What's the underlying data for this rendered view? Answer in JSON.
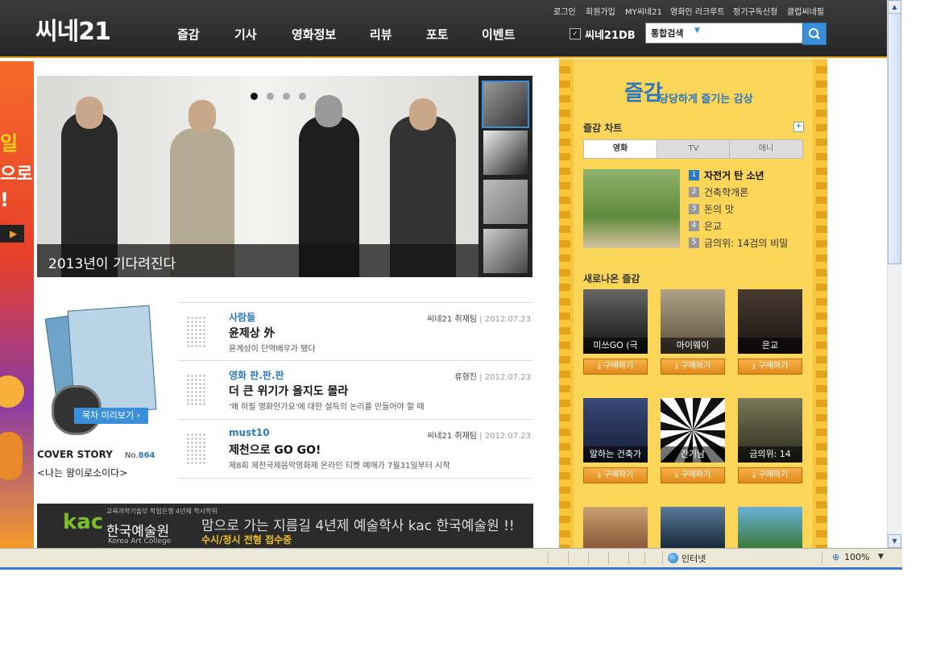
{
  "header": {
    "logo": "씨네21",
    "nav": [
      "즐감",
      "기사",
      "영화정보",
      "리뷰",
      "포토",
      "이벤트"
    ],
    "util_links": [
      "로그인",
      "회원가입",
      "MY씨네21",
      "영화인 리크루트",
      "정기구독신청",
      "클럽씨네필"
    ],
    "db_label": "씨네21DB",
    "search_scope": "통합검색",
    "search_value": ""
  },
  "left_ad": {
    "texts": [
      "일",
      "으로",
      "!"
    ]
  },
  "hero": {
    "caption": "2013년이 기다려진다",
    "dots": 4,
    "active_dot": 0
  },
  "cover": {
    "toc_button": "목차 미리보기 ›",
    "label": "COVER STORY",
    "no_prefix": "No.",
    "no_value": "864",
    "title": "<나는 왕이로소이다>"
  },
  "articles": [
    {
      "category": "사람들",
      "author": "씨네21 취재팀",
      "date": "2012.07.23",
      "title": "윤제상 外",
      "desc": "윤계상이 단역배우가 됐다"
    },
    {
      "category": "영화 판.판.판",
      "author": "류형진",
      "date": "2012.07.23",
      "title": "더 큰 위기가 올지도 몰라",
      "desc": "'왜 하필 영화인가요'에 대한 설득의 논리를 만들어야 할 때"
    },
    {
      "category": "must10",
      "author": "씨네21 취재팀",
      "date": "2012.07.23",
      "title": "제천으로 GO GO!",
      "desc": "제8회 제천국제음악영화제 온라인 티켓 예매가 7월31일부터 시작"
    }
  ],
  "banner": {
    "sub": "교육과학기술부 학점은행 4년제 학사학위",
    "logo": "kac",
    "school": "한국예술원",
    "school_en": "Korea Art College",
    "headline": "맘으로 가는 지름길 4년제 예술학사 kac 한국예술원 !!",
    "cta": "수시/정시 전형 접수중"
  },
  "jeulgam": {
    "logo": "즐감",
    "slogan": "당당하게 즐기는 감상",
    "chart_title": "즐감 차트",
    "more": "+",
    "tabs": [
      "영화",
      "TV",
      "애니"
    ],
    "active_tab": 0,
    "chart": [
      {
        "rank": "1",
        "title": "자전거 탄 소년"
      },
      {
        "rank": "2",
        "title": "건축학개론"
      },
      {
        "rank": "3",
        "title": "돈의 맛"
      },
      {
        "rank": "4",
        "title": "은교"
      },
      {
        "rank": "5",
        "title": "금의위: 14검의 비밀"
      }
    ],
    "new_title": "새로나온 즐감",
    "buy_label": "구매하기",
    "posters": [
      "미쓰GO (극",
      "마이웨이",
      "은교",
      "말하는 건축가",
      "간기남",
      "금의위: 14"
    ]
  },
  "statusbar": {
    "zone": "인터넷",
    "zoom": "100%"
  },
  "colors": {
    "accent": "#3a8fd8",
    "panel": "#f8c63c",
    "header": "#2b2b2b"
  }
}
